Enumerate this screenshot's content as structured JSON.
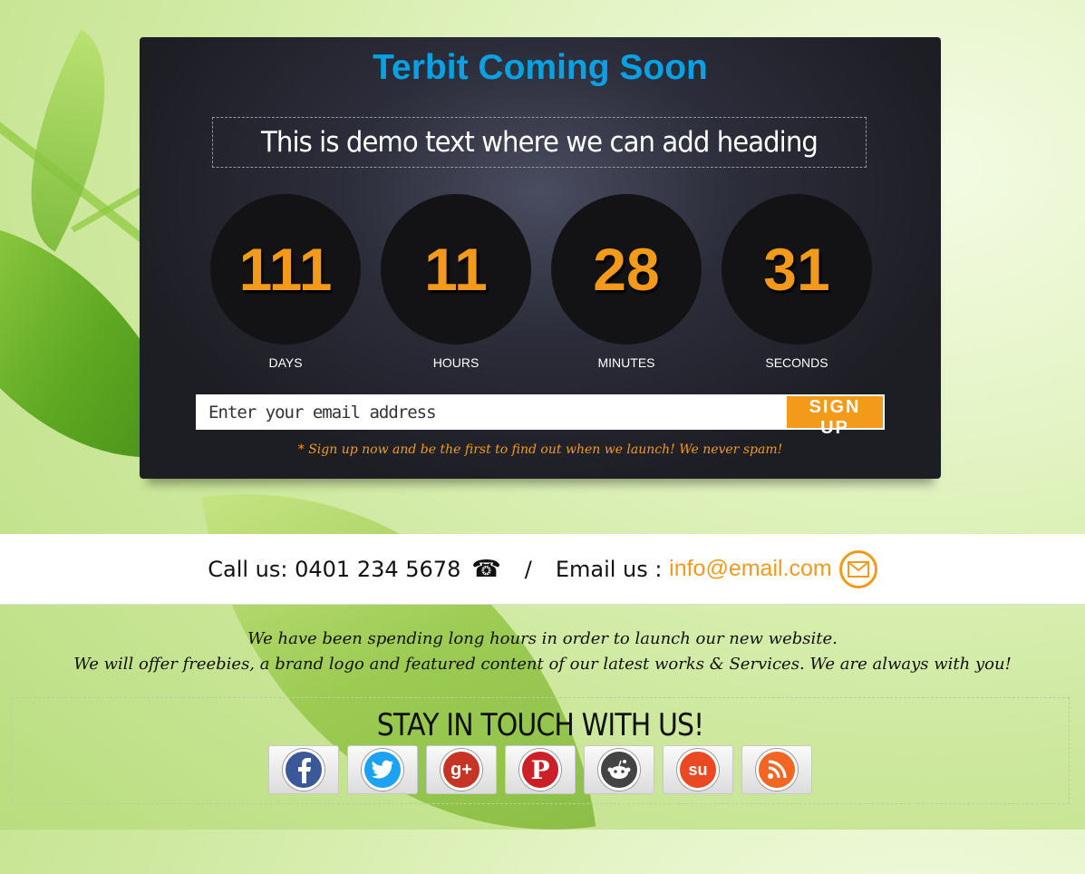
{
  "header": {
    "title": "Terbit Coming Soon",
    "headline": "This is demo text where we can add heading"
  },
  "countdown": [
    {
      "value": "111",
      "label": "DAYS"
    },
    {
      "value": "11",
      "label": "HOURS"
    },
    {
      "value": "28",
      "label": "MINUTES"
    },
    {
      "value": "31",
      "label": "SECONDS"
    }
  ],
  "signup": {
    "placeholder": "Enter your email address",
    "button_label": "SIGN UP",
    "note": "* Sign up now and be the first to find out when we launch! We never spam!"
  },
  "contact": {
    "call_label": "Call us:",
    "phone": "0401 234 5678",
    "separator": "/",
    "email_label": "Email us :",
    "email": "info@email.com"
  },
  "about": {
    "line1": "We have been spending long hours in order to launch our new website.",
    "line2": "We will offer freebies, a brand logo and featured content of our latest works & Services. We are always with you!"
  },
  "social": {
    "title": "STAY IN TOUCH WITH US!",
    "items": [
      {
        "name": "facebook",
        "glyph": "f",
        "color": "#3b5998"
      },
      {
        "name": "twitter",
        "glyph": "t",
        "color": "#1da1f2"
      },
      {
        "name": "google-plus",
        "glyph": "g+",
        "color": "#c53424"
      },
      {
        "name": "pinterest",
        "glyph": "P",
        "color": "#cb2027"
      },
      {
        "name": "reddit",
        "glyph": "r",
        "color": "#444444"
      },
      {
        "name": "stumbleupon",
        "glyph": "su",
        "color": "#eb4924"
      },
      {
        "name": "rss",
        "glyph": "rss",
        "color": "#f26522"
      }
    ]
  },
  "colors": {
    "accent": "#f39a1b",
    "title_blue": "#0aa1e4",
    "panel": "#1d1d24"
  }
}
